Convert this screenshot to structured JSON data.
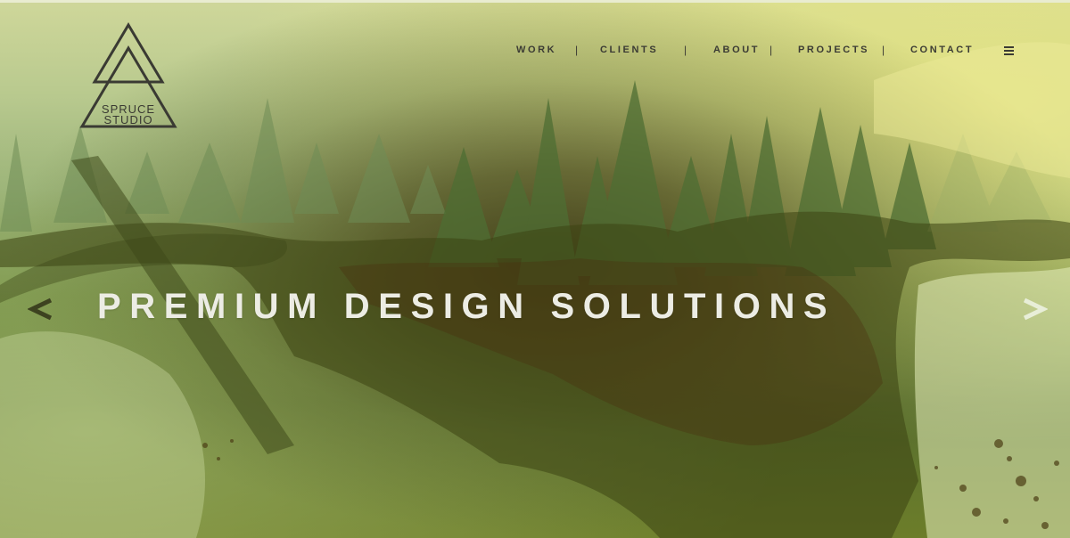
{
  "brand": {
    "line1": "SPRUCE",
    "line2": "STUDIO",
    "logo_icon": "double-triangle-logo-icon"
  },
  "nav": {
    "items": [
      {
        "label": "WORK"
      },
      {
        "label": "CLIENTS"
      },
      {
        "label": "ABOUT"
      },
      {
        "label": "PROJECTS"
      },
      {
        "label": "CONTACT"
      }
    ],
    "separator": "|",
    "menu_icon": "hamburger-menu-icon"
  },
  "hero": {
    "headline": "PREMIUM DESIGN SOLUTIONS",
    "prev_icon": "chevron-left-icon",
    "next_icon": "chevron-right-icon"
  },
  "colors": {
    "nav_text": "#3b3b34",
    "headline_text": "#ecece4",
    "accent_green": "#58702f"
  }
}
